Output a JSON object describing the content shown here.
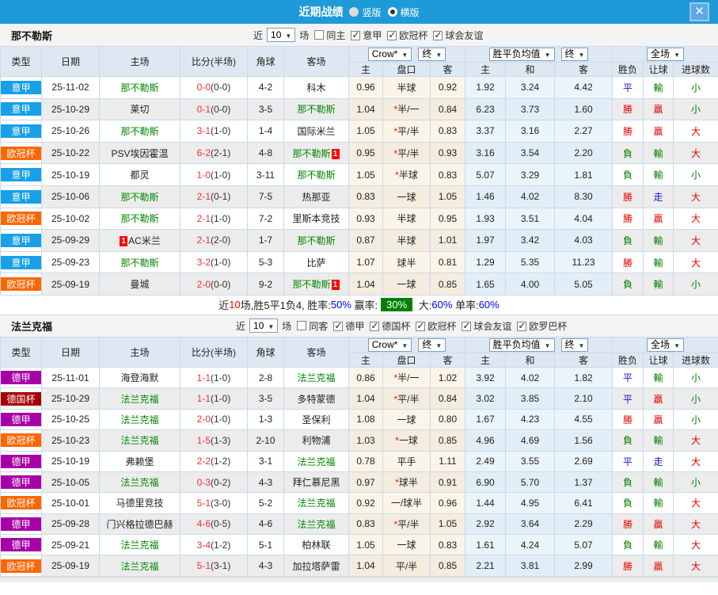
{
  "titlebar": {
    "title": "近期战绩",
    "close_icon": "✕",
    "layout_options": [
      {
        "label": "竖版",
        "selected": false
      },
      {
        "label": "横版",
        "selected": true
      }
    ]
  },
  "controls": {
    "odds_company": "Crow*",
    "final1": "终",
    "avg_label": "胜平负均值",
    "final2": "终",
    "scope": "全场"
  },
  "columns": {
    "type": "类型",
    "date": "日期",
    "home": "主场",
    "score": "比分(半场)",
    "corner": "角球",
    "away": "客场",
    "odds_home": "主",
    "odds_handicap": "盘口",
    "odds_away": "客",
    "avg_home": "主",
    "avg_draw": "和",
    "avg_away": "客",
    "result_wdl": "胜负",
    "result_handicap": "让球",
    "result_goals": "进球数"
  },
  "league_colors": {
    "意甲": "#18a0e8",
    "欧冠杯": "#ff6600",
    "德甲": "#a800a8",
    "德国杯": "#a40000"
  },
  "result_colors": {
    "r": "#e60000",
    "b": "#1414d4",
    "g": "#008000"
  },
  "sections": [
    {
      "team": "那不勒斯",
      "filter": {
        "prefix": "近",
        "count": "10",
        "suffix": "场",
        "same": {
          "label": "同主",
          "checked": false
        },
        "leagues": [
          {
            "label": "意甲",
            "checked": true
          },
          {
            "label": "欧冠杯",
            "checked": true
          },
          {
            "label": "球会友谊",
            "checked": true
          }
        ]
      },
      "rows": [
        {
          "league": "意甲",
          "date": "25-11-02",
          "home": "那不勒斯",
          "home_green": true,
          "score_ft": "0-0",
          "score_ht": "(0-0)",
          "corner": "4-2",
          "away": "科木",
          "away_green": false,
          "odds": [
            "0.96",
            "半球",
            "0.92"
          ],
          "star": false,
          "avg": [
            "1.92",
            "3.24",
            "4.42"
          ],
          "res": [
            [
              "平",
              "b"
            ],
            [
              "輸",
              "g"
            ],
            [
              "小",
              "g"
            ]
          ]
        },
        {
          "league": "意甲",
          "date": "25-10-29",
          "home": "莱切",
          "home_green": false,
          "score_ft": "0-1",
          "score_ht": "(0-0)",
          "corner": "3-5",
          "away": "那不勒斯",
          "away_green": true,
          "odds": [
            "1.04",
            "半/一",
            "0.84"
          ],
          "star": true,
          "avg": [
            "6.23",
            "3.73",
            "1.60"
          ],
          "res": [
            [
              "勝",
              "r"
            ],
            [
              "贏",
              "r"
            ],
            [
              "小",
              "g"
            ]
          ]
        },
        {
          "league": "意甲",
          "date": "25-10-26",
          "home": "那不勒斯",
          "home_green": true,
          "score_ft": "3-1",
          "score_ht": "(1-0)",
          "corner": "1-4",
          "away": "国际米兰",
          "away_green": false,
          "odds": [
            "1.05",
            "平/半",
            "0.83"
          ],
          "star": true,
          "avg": [
            "3.37",
            "3.16",
            "2.27"
          ],
          "res": [
            [
              "勝",
              "r"
            ],
            [
              "贏",
              "r"
            ],
            [
              "大",
              "r"
            ]
          ]
        },
        {
          "league": "欧冠杯",
          "date": "25-10-22",
          "home": "PSV埃因霍温",
          "home_green": false,
          "score_ft": "6-2",
          "score_ht": "(2-1)",
          "corner": "4-8",
          "away": "那不勒斯",
          "away_green": true,
          "away_redcard": "1",
          "odds": [
            "0.95",
            "平/半",
            "0.93"
          ],
          "star": true,
          "avg": [
            "3.16",
            "3.54",
            "2.20"
          ],
          "res": [
            [
              "負",
              "g"
            ],
            [
              "輸",
              "g"
            ],
            [
              "大",
              "r"
            ]
          ]
        },
        {
          "league": "意甲",
          "date": "25-10-19",
          "home": "都灵",
          "home_green": false,
          "score_ft": "1-0",
          "score_ht": "(1-0)",
          "corner": "3-11",
          "away": "那不勒斯",
          "away_green": true,
          "odds": [
            "1.05",
            "半球",
            "0.83"
          ],
          "star": true,
          "avg": [
            "5.07",
            "3.29",
            "1.81"
          ],
          "res": [
            [
              "負",
              "g"
            ],
            [
              "輸",
              "g"
            ],
            [
              "小",
              "g"
            ]
          ]
        },
        {
          "league": "意甲",
          "date": "25-10-06",
          "home": "那不勒斯",
          "home_green": true,
          "score_ft": "2-1",
          "score_ht": "(0-1)",
          "corner": "7-5",
          "away": "热那亚",
          "away_green": false,
          "odds": [
            "0.83",
            "一球",
            "1.05"
          ],
          "star": false,
          "avg": [
            "1.46",
            "4.02",
            "8.30"
          ],
          "res": [
            [
              "勝",
              "r"
            ],
            [
              "走",
              "b"
            ],
            [
              "大",
              "r"
            ]
          ]
        },
        {
          "league": "欧冠杯",
          "date": "25-10-02",
          "home": "那不勒斯",
          "home_green": true,
          "score_ft": "2-1",
          "score_ht": "(1-0)",
          "corner": "7-2",
          "away": "里斯本竞技",
          "away_green": false,
          "odds": [
            "0.93",
            "半球",
            "0.95"
          ],
          "star": false,
          "avg": [
            "1.93",
            "3.51",
            "4.04"
          ],
          "res": [
            [
              "勝",
              "r"
            ],
            [
              "贏",
              "r"
            ],
            [
              "大",
              "r"
            ]
          ]
        },
        {
          "league": "意甲",
          "date": "25-09-29",
          "home": "AC米兰",
          "home_green": false,
          "home_redcard": "1",
          "score_ft": "2-1",
          "score_ht": "(2-0)",
          "corner": "1-7",
          "away": "那不勒斯",
          "away_green": true,
          "odds": [
            "0.87",
            "半球",
            "1.01"
          ],
          "star": false,
          "avg": [
            "1.97",
            "3.42",
            "4.03"
          ],
          "res": [
            [
              "負",
              "g"
            ],
            [
              "輸",
              "g"
            ],
            [
              "大",
              "r"
            ]
          ]
        },
        {
          "league": "意甲",
          "date": "25-09-23",
          "home": "那不勒斯",
          "home_green": true,
          "score_ft": "3-2",
          "score_ht": "(1-0)",
          "corner": "5-3",
          "away": "比萨",
          "away_green": false,
          "odds": [
            "1.07",
            "球半",
            "0.81"
          ],
          "star": false,
          "avg": [
            "1.29",
            "5.35",
            "11.23"
          ],
          "res": [
            [
              "勝",
              "r"
            ],
            [
              "輸",
              "g"
            ],
            [
              "大",
              "r"
            ]
          ]
        },
        {
          "league": "欧冠杯",
          "date": "25-09-19",
          "home": "曼城",
          "home_green": false,
          "score_ft": "2-0",
          "score_ht": "(0-0)",
          "corner": "9-2",
          "away": "那不勒斯",
          "away_green": true,
          "away_redcard": "1",
          "odds": [
            "1.04",
            "一球",
            "0.85"
          ],
          "star": false,
          "avg": [
            "1.65",
            "4.00",
            "5.05"
          ],
          "res": [
            [
              "負",
              "g"
            ],
            [
              "輸",
              "g"
            ],
            [
              "小",
              "g"
            ]
          ]
        }
      ],
      "summary": [
        {
          "t": "近",
          "c": "k"
        },
        {
          "t": "10",
          "c": "r"
        },
        {
          "t": "场,胜5平1负4, 胜率:",
          "c": "k"
        },
        {
          "t": "50%",
          "c": "b"
        },
        {
          "t": " 赢率:",
          "c": "k"
        },
        {
          "t": "30%",
          "c": "gbox"
        },
        {
          "t": " 大:",
          "c": "k"
        },
        {
          "t": "60%",
          "c": "b"
        },
        {
          "t": " 单率:",
          "c": "k"
        },
        {
          "t": "60%",
          "c": "b"
        }
      ]
    },
    {
      "team": "法兰克福",
      "filter": {
        "prefix": "近",
        "count": "10",
        "suffix": "场",
        "same": {
          "label": "同客",
          "checked": false
        },
        "leagues": [
          {
            "label": "德甲",
            "checked": true
          },
          {
            "label": "德国杯",
            "checked": true
          },
          {
            "label": "欧冠杯",
            "checked": true
          },
          {
            "label": "球会友谊",
            "checked": true
          },
          {
            "label": "欧罗巴杯",
            "checked": true
          }
        ]
      },
      "rows": [
        {
          "league": "德甲",
          "date": "25-11-01",
          "home": "海登海默",
          "home_green": false,
          "score_ft": "1-1",
          "score_ht": "(1-0)",
          "corner": "2-8",
          "away": "法兰克福",
          "away_green": true,
          "odds": [
            "0.86",
            "半/一",
            "1.02"
          ],
          "star": true,
          "avg": [
            "3.92",
            "4.02",
            "1.82"
          ],
          "res": [
            [
              "平",
              "b"
            ],
            [
              "輸",
              "g"
            ],
            [
              "小",
              "g"
            ]
          ]
        },
        {
          "league": "德国杯",
          "date": "25-10-29",
          "home": "法兰克福",
          "home_green": true,
          "score_ft": "1-1",
          "score_ht": "(1-0)",
          "corner": "3-5",
          "away": "多特蒙德",
          "away_green": false,
          "odds": [
            "1.04",
            "平/半",
            "0.84"
          ],
          "star": true,
          "avg": [
            "3.02",
            "3.85",
            "2.10"
          ],
          "res": [
            [
              "平",
              "b"
            ],
            [
              "贏",
              "r"
            ],
            [
              "小",
              "g"
            ]
          ]
        },
        {
          "league": "德甲",
          "date": "25-10-25",
          "home": "法兰克福",
          "home_green": true,
          "score_ft": "2-0",
          "score_ht": "(1-0)",
          "corner": "1-3",
          "away": "圣保利",
          "away_green": false,
          "odds": [
            "1.08",
            "一球",
            "0.80"
          ],
          "star": false,
          "avg": [
            "1.67",
            "4.23",
            "4.55"
          ],
          "res": [
            [
              "勝",
              "r"
            ],
            [
              "贏",
              "r"
            ],
            [
              "小",
              "g"
            ]
          ]
        },
        {
          "league": "欧冠杯",
          "date": "25-10-23",
          "home": "法兰克福",
          "home_green": true,
          "score_ft": "1-5",
          "score_ht": "(1-3)",
          "corner": "2-10",
          "away": "利物浦",
          "away_green": false,
          "odds": [
            "1.03",
            "一球",
            "0.85"
          ],
          "star": true,
          "avg": [
            "4.96",
            "4.69",
            "1.56"
          ],
          "res": [
            [
              "負",
              "g"
            ],
            [
              "輸",
              "g"
            ],
            [
              "大",
              "r"
            ]
          ]
        },
        {
          "league": "德甲",
          "date": "25-10-19",
          "home": "弗赖堡",
          "home_green": false,
          "score_ft": "2-2",
          "score_ht": "(1-2)",
          "corner": "3-1",
          "away": "法兰克福",
          "away_green": true,
          "odds": [
            "0.78",
            "平手",
            "1.11"
          ],
          "star": false,
          "avg": [
            "2.49",
            "3.55",
            "2.69"
          ],
          "res": [
            [
              "平",
              "b"
            ],
            [
              "走",
              "b"
            ],
            [
              "大",
              "r"
            ]
          ]
        },
        {
          "league": "德甲",
          "date": "25-10-05",
          "home": "法兰克福",
          "home_green": true,
          "score_ft": "0-3",
          "score_ht": "(0-2)",
          "corner": "4-3",
          "away": "拜仁慕尼黑",
          "away_green": false,
          "odds": [
            "0.97",
            "球半",
            "0.91"
          ],
          "star": true,
          "avg": [
            "6.90",
            "5.70",
            "1.37"
          ],
          "res": [
            [
              "負",
              "g"
            ],
            [
              "輸",
              "g"
            ],
            [
              "小",
              "g"
            ]
          ]
        },
        {
          "league": "欧冠杯",
          "date": "25-10-01",
          "home": "马德里竞技",
          "home_green": false,
          "score_ft": "5-1",
          "score_ht": "(3-0)",
          "corner": "5-2",
          "away": "法兰克福",
          "away_green": true,
          "odds": [
            "0.92",
            "一/球半",
            "0.96"
          ],
          "star": false,
          "avg": [
            "1.44",
            "4.95",
            "6.41"
          ],
          "res": [
            [
              "負",
              "g"
            ],
            [
              "輸",
              "g"
            ],
            [
              "大",
              "r"
            ]
          ]
        },
        {
          "league": "德甲",
          "date": "25-09-28",
          "home": "门兴格拉德巴赫",
          "home_green": false,
          "score_ft": "4-6",
          "score_ht": "(0-5)",
          "corner": "4-6",
          "away": "法兰克福",
          "away_green": true,
          "odds": [
            "0.83",
            "平/半",
            "1.05"
          ],
          "star": true,
          "avg": [
            "2.92",
            "3.64",
            "2.29"
          ],
          "res": [
            [
              "勝",
              "r"
            ],
            [
              "贏",
              "r"
            ],
            [
              "大",
              "r"
            ]
          ]
        },
        {
          "league": "德甲",
          "date": "25-09-21",
          "home": "法兰克福",
          "home_green": true,
          "score_ft": "3-4",
          "score_ht": "(1-2)",
          "corner": "5-1",
          "away": "柏林联",
          "away_green": false,
          "odds": [
            "1.05",
            "一球",
            "0.83"
          ],
          "star": false,
          "avg": [
            "1.61",
            "4.24",
            "5.07"
          ],
          "res": [
            [
              "負",
              "g"
            ],
            [
              "輸",
              "g"
            ],
            [
              "大",
              "r"
            ]
          ]
        },
        {
          "league": "欧冠杯",
          "date": "25-09-19",
          "home": "法兰克福",
          "home_green": true,
          "score_ft": "5-1",
          "score_ht": "(3-1)",
          "corner": "4-3",
          "away": "加拉塔萨雷",
          "away_green": false,
          "odds": [
            "1.04",
            "平/半",
            "0.85"
          ],
          "star": false,
          "avg": [
            "2.21",
            "3.81",
            "2.99"
          ],
          "res": [
            [
              "勝",
              "r"
            ],
            [
              "贏",
              "r"
            ],
            [
              "大",
              "r"
            ]
          ]
        }
      ],
      "summary": null
    }
  ]
}
